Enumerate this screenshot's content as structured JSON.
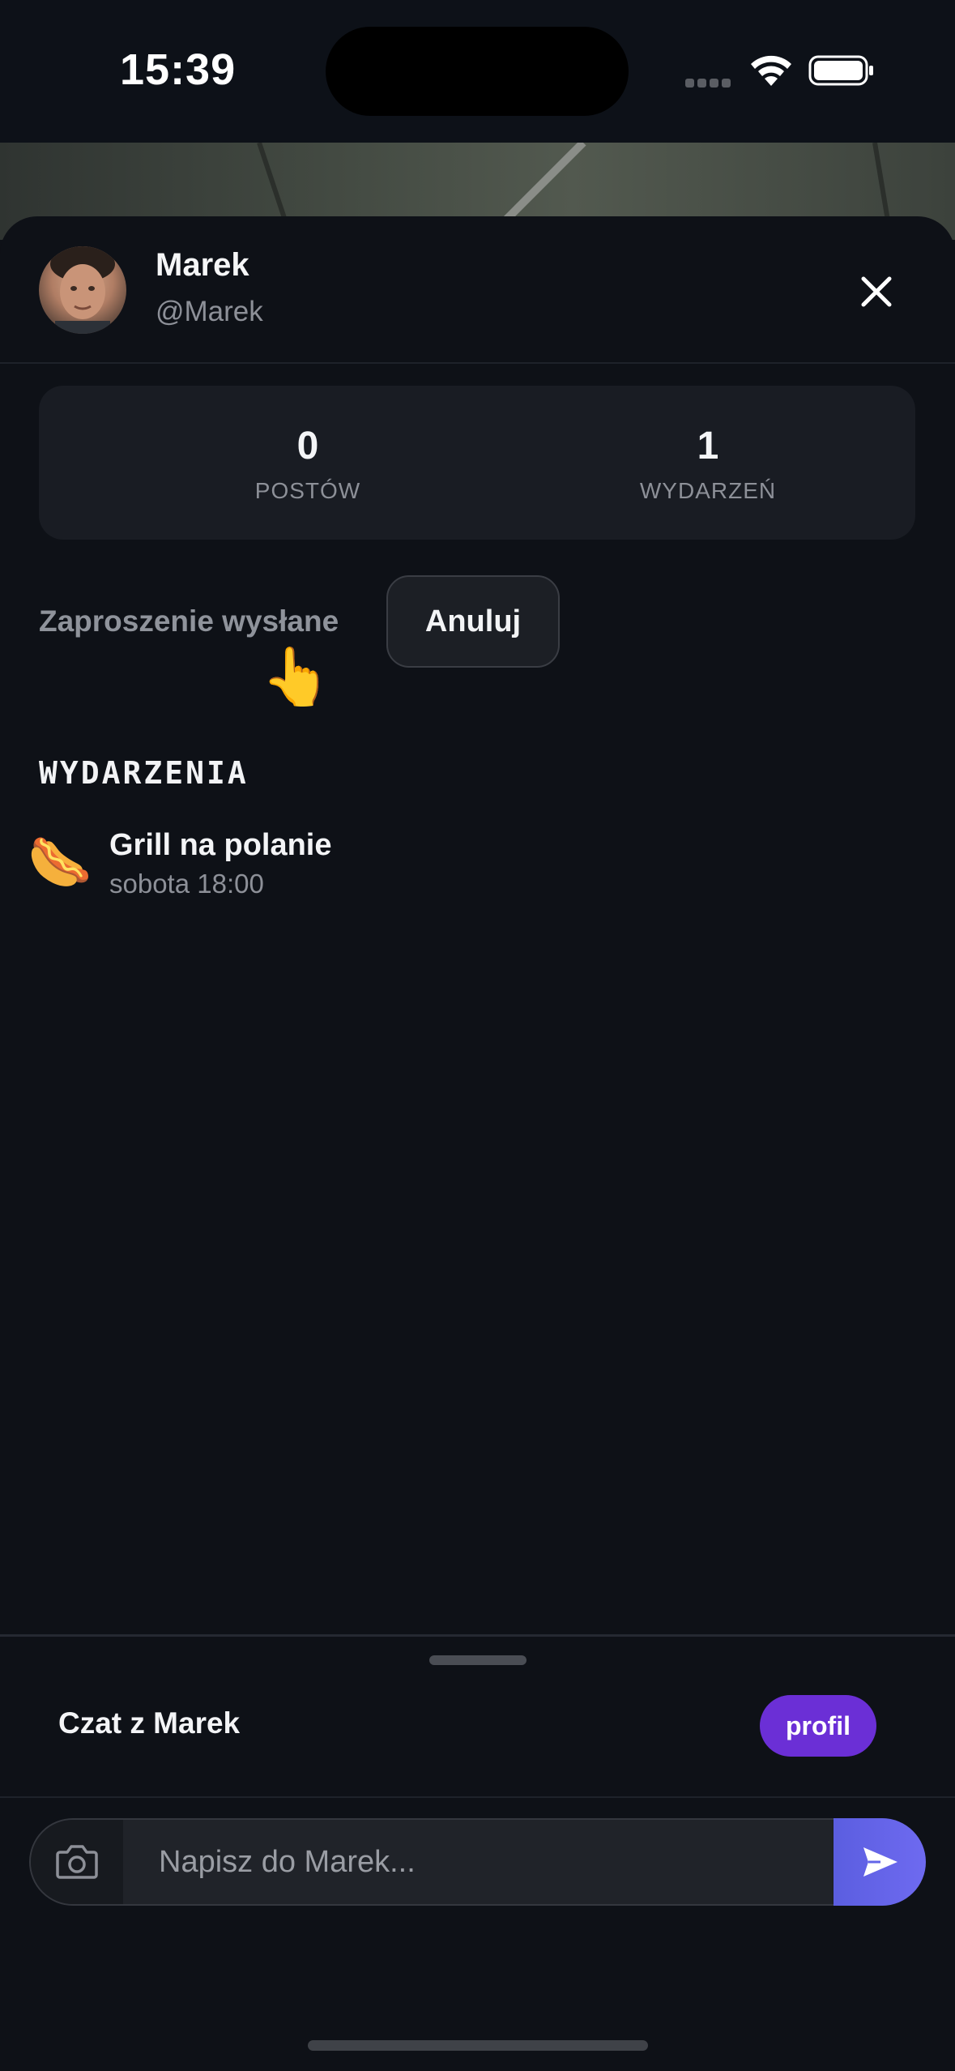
{
  "status_bar": {
    "time": "15:39"
  },
  "profile": {
    "name": "Marek",
    "handle": "@Marek"
  },
  "stats": [
    {
      "value": "0",
      "label": "POSTÓW"
    },
    {
      "value": "1",
      "label": "WYDARZEŃ"
    }
  ],
  "invite": {
    "status": "Zaproszenie wysłane",
    "cancel_label": "Anuluj"
  },
  "events_section": {
    "title": "WYDARZENIA",
    "items": [
      {
        "emoji": "🌭",
        "title": "Grill na polanie",
        "time": "sobota 18:00"
      }
    ]
  },
  "chat": {
    "title": "Czat z Marek",
    "profile_label": "profil",
    "input_placeholder": "Napisz do Marek..."
  },
  "colors": {
    "background": "#0e1117",
    "card": "#191c23",
    "accent_purple": "#6b2fd6",
    "send_gradient": "#5b5ee0",
    "muted_text": "#8d9098"
  },
  "icons": [
    "wifi-icon",
    "battery-icon",
    "close-icon",
    "pointing-hand-icon",
    "camera-icon",
    "send-icon"
  ]
}
